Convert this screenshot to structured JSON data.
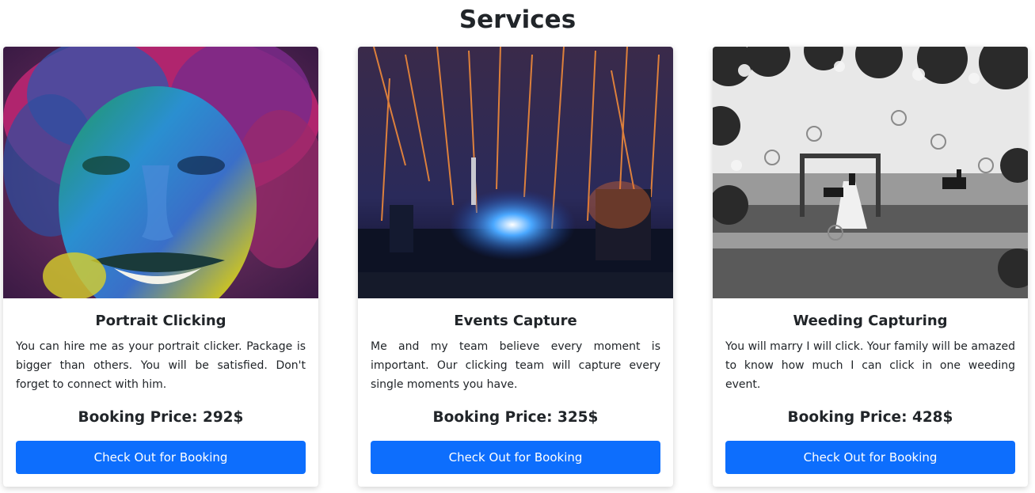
{
  "page": {
    "title": "Services"
  },
  "colors": {
    "accent": "#0d6efd",
    "text": "#212529"
  },
  "services": [
    {
      "image": "portrait-holi-face-photo",
      "title": "Portrait Clicking",
      "description": "You can hire me as your portrait clicker. Package is bigger than others. You will be satisfied. Don't forget to connect with him.",
      "price": "Booking Price: 292$",
      "button_label": "Check Out for Booking"
    },
    {
      "image": "fireworks-event-photo",
      "title": "Events Capture",
      "description": "Me and my team believe every moment is important. Our clicking team will capture every single moments you have.",
      "price": "Booking Price: 325$",
      "button_label": "Check Out for Booking"
    },
    {
      "image": "beach-wedding-bw-photo",
      "title": "Weeding Capturing",
      "description": "You will marry I will click. Your family will be amazed to know how much I can click in one weeding event.",
      "price": "Booking Price: 428$",
      "button_label": "Check Out for Booking"
    }
  ]
}
